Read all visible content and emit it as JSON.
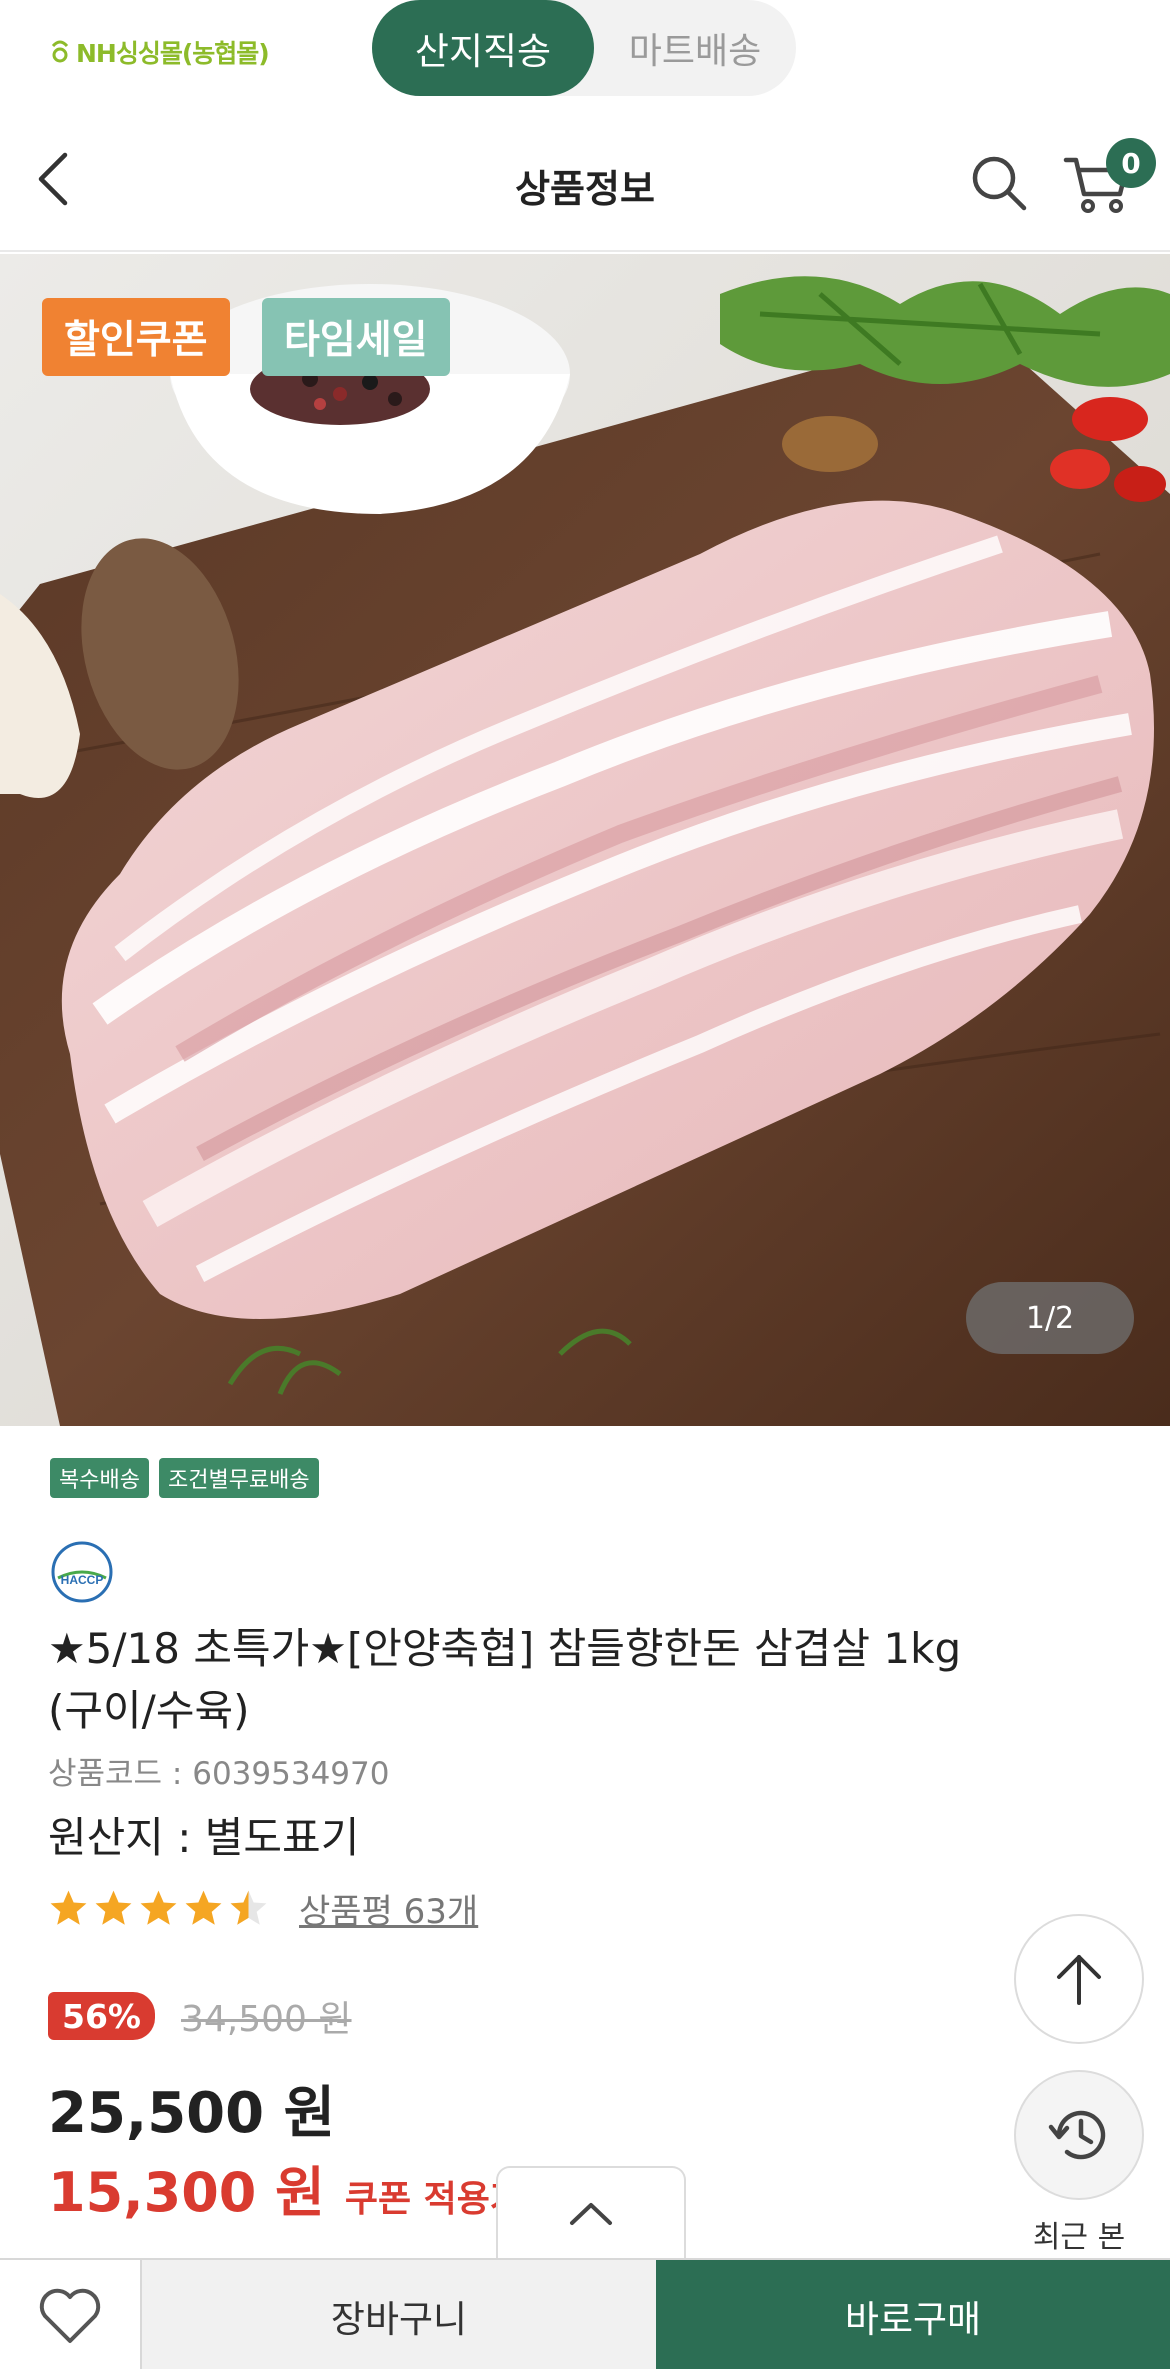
{
  "mall": {
    "logo_text": "NH싱싱몰(농협몰)",
    "tabs": [
      {
        "label": "산지직송",
        "active": true
      },
      {
        "label": "마트배송",
        "active": false
      }
    ]
  },
  "header": {
    "title": "상품정보",
    "cart_count": "0"
  },
  "hero": {
    "badges": [
      "할인쿠폰",
      "타임세일"
    ],
    "counter": "1/2"
  },
  "product": {
    "tags": [
      "복수배송",
      "조건별무료배송"
    ],
    "certification": "HACCP",
    "title": "★5/18 초특가★[안양축협] 참들향한돈 삼겹살 1kg (구이/수육)",
    "code": "상품코드 : 6039534970",
    "origin": "원산지 : 별도표기",
    "rating": 4.5,
    "review_link": "상품평 63개",
    "discount_rate": "56%",
    "original_price": "34,500 원",
    "sale_price": "25,500 원",
    "coupon_price": "15,300 원",
    "coupon_label": "쿠폰 적용가"
  },
  "floating": {
    "recent_label": "최근 본"
  },
  "bottom_bar": {
    "cart_label": "장바구니",
    "buy_label": "바로구매"
  },
  "colors": {
    "brand_green": "#2c6e54",
    "coupon_orange": "#f08232",
    "timesale_mint": "#86c3b3",
    "sale_red": "#d93b30",
    "star": "#f5a623"
  }
}
